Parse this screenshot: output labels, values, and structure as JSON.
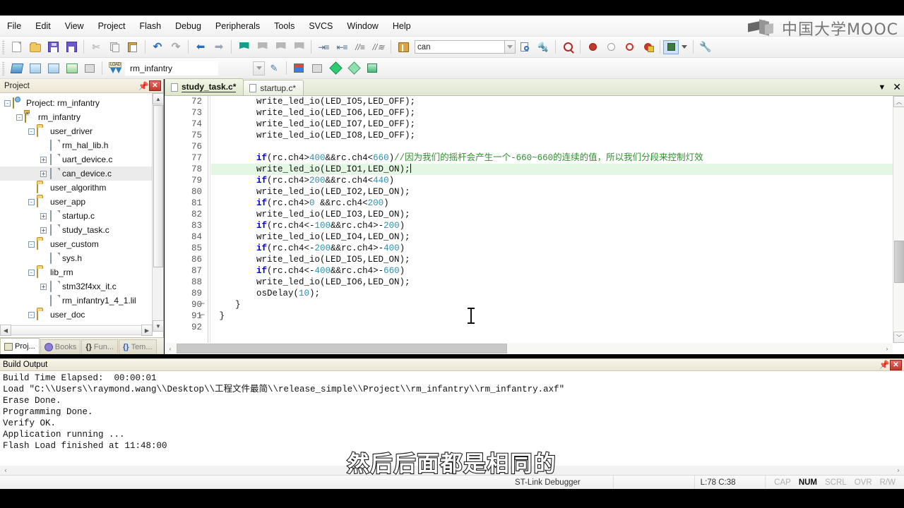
{
  "app": {
    "title": "Keil uVision",
    "logo_text": "中国大学MOOC"
  },
  "menubar": {
    "items": [
      "File",
      "Edit",
      "View",
      "Project",
      "Flash",
      "Debug",
      "Peripherals",
      "Tools",
      "SVCS",
      "Window",
      "Help"
    ]
  },
  "toolbar": {
    "search_value": "can",
    "search_placeholder": "",
    "target_value": "rm_infantry"
  },
  "project_panel": {
    "title": "Project",
    "tree": [
      {
        "label": "Project: rm_infantry",
        "depth": 0,
        "expander": "-",
        "icon": "project-icon",
        "selected": false
      },
      {
        "label": "rm_infantry",
        "depth": 1,
        "expander": "-",
        "icon": "target-icon",
        "selected": false
      },
      {
        "label": "user_driver",
        "depth": 2,
        "expander": "-",
        "icon": "folder-icon",
        "selected": false
      },
      {
        "label": "rm_hal_lib.h",
        "depth": 3,
        "expander": "",
        "icon": "file-icon",
        "selected": false
      },
      {
        "label": "uart_device.c",
        "depth": 3,
        "expander": "+",
        "icon": "file-icon",
        "selected": false
      },
      {
        "label": "can_device.c",
        "depth": 3,
        "expander": "+",
        "icon": "file-icon",
        "selected": true
      },
      {
        "label": "user_algorithm",
        "depth": 2,
        "expander": "",
        "icon": "folder-icon",
        "selected": false
      },
      {
        "label": "user_app",
        "depth": 2,
        "expander": "-",
        "icon": "folder-icon",
        "selected": false
      },
      {
        "label": "startup.c",
        "depth": 3,
        "expander": "+",
        "icon": "file-icon",
        "selected": false
      },
      {
        "label": "study_task.c",
        "depth": 3,
        "expander": "+",
        "icon": "file-icon",
        "selected": false
      },
      {
        "label": "user_custom",
        "depth": 2,
        "expander": "-",
        "icon": "folder-icon",
        "selected": false
      },
      {
        "label": "sys.h",
        "depth": 3,
        "expander": "",
        "icon": "file-icon",
        "selected": false
      },
      {
        "label": "lib_rm",
        "depth": 2,
        "expander": "-",
        "icon": "folder-icon",
        "selected": false
      },
      {
        "label": "stm32f4xx_it.c",
        "depth": 3,
        "expander": "+",
        "icon": "file-icon",
        "selected": false
      },
      {
        "label": "rm_infantry1_4_1.lil",
        "depth": 3,
        "expander": "",
        "icon": "file-icon",
        "selected": false
      },
      {
        "label": "user_doc",
        "depth": 2,
        "expander": "-",
        "icon": "folder-icon",
        "selected": false
      }
    ],
    "tabs": [
      {
        "label": "Proj...",
        "active": true,
        "icon": "project-tab-icon"
      },
      {
        "label": "Books",
        "active": false,
        "icon": "books-tab-icon"
      },
      {
        "label": "Fun...",
        "active": false,
        "icon": "functions-tab-icon"
      },
      {
        "label": "Tem...",
        "active": false,
        "icon": "templates-tab-icon"
      }
    ]
  },
  "editor": {
    "tabs": [
      {
        "label": "startup.c*",
        "active": false
      },
      {
        "label": "study_task.c*",
        "active": true
      }
    ],
    "first_line_number": 72,
    "lines": [
      {
        "n": 72,
        "indent": 8,
        "tokens": [
          {
            "t": "write_led_io(LED_IO5,LED_OFF);",
            "c": "plain"
          }
        ],
        "highlight": false
      },
      {
        "n": 73,
        "indent": 8,
        "tokens": [
          {
            "t": "write_led_io(LED_IO6,LED_OFF);",
            "c": "plain"
          }
        ],
        "highlight": false
      },
      {
        "n": 74,
        "indent": 8,
        "tokens": [
          {
            "t": "write_led_io(LED_IO7,LED_OFF);",
            "c": "plain"
          }
        ],
        "highlight": false
      },
      {
        "n": 75,
        "indent": 8,
        "tokens": [
          {
            "t": "write_led_io(LED_IO8,LED_OFF);",
            "c": "plain"
          }
        ],
        "highlight": false
      },
      {
        "n": 76,
        "indent": 0,
        "tokens": [],
        "highlight": false
      },
      {
        "n": 77,
        "indent": 8,
        "tokens": [
          {
            "t": "if",
            "c": "kw"
          },
          {
            "t": "(rc.ch4>",
            "c": "plain"
          },
          {
            "t": "400",
            "c": "num"
          },
          {
            "t": "&&rc.ch4<",
            "c": "plain"
          },
          {
            "t": "660",
            "c": "num"
          },
          {
            "t": ")",
            "c": "plain"
          },
          {
            "t": "//因为我们的摇杆会产生一个-660~660的连续的值，所以我们分段来控制灯效",
            "c": "com"
          }
        ],
        "highlight": false
      },
      {
        "n": 78,
        "indent": 8,
        "tokens": [
          {
            "t": "write_led_io(LED_IO1,LED_ON);",
            "c": "plain"
          }
        ],
        "highlight": true,
        "caret": true
      },
      {
        "n": 79,
        "indent": 8,
        "tokens": [
          {
            "t": "if",
            "c": "kw"
          },
          {
            "t": "(rc.ch4>",
            "c": "plain"
          },
          {
            "t": "200",
            "c": "num"
          },
          {
            "t": "&&rc.ch4<",
            "c": "plain"
          },
          {
            "t": "440",
            "c": "num"
          },
          {
            "t": ")",
            "c": "plain"
          }
        ],
        "highlight": false
      },
      {
        "n": 80,
        "indent": 8,
        "tokens": [
          {
            "t": "write_led_io(LED_IO2,LED_ON);",
            "c": "plain"
          }
        ],
        "highlight": false
      },
      {
        "n": 81,
        "indent": 8,
        "tokens": [
          {
            "t": "if",
            "c": "kw"
          },
          {
            "t": "(rc.ch4>",
            "c": "plain"
          },
          {
            "t": "0",
            "c": "num"
          },
          {
            "t": " &&rc.ch4<",
            "c": "plain"
          },
          {
            "t": "200",
            "c": "num"
          },
          {
            "t": ")",
            "c": "plain"
          }
        ],
        "highlight": false
      },
      {
        "n": 82,
        "indent": 8,
        "tokens": [
          {
            "t": "write_led_io(LED_IO3,LED_ON);",
            "c": "plain"
          }
        ],
        "highlight": false
      },
      {
        "n": 83,
        "indent": 8,
        "tokens": [
          {
            "t": "if",
            "c": "kw"
          },
          {
            "t": "(rc.ch4<-",
            "c": "plain"
          },
          {
            "t": "100",
            "c": "num"
          },
          {
            "t": "&&rc.ch4>-",
            "c": "plain"
          },
          {
            "t": "200",
            "c": "num"
          },
          {
            "t": ")",
            "c": "plain"
          }
        ],
        "highlight": false
      },
      {
        "n": 84,
        "indent": 8,
        "tokens": [
          {
            "t": "write_led_io(LED_IO4,LED_ON);",
            "c": "plain"
          }
        ],
        "highlight": false
      },
      {
        "n": 85,
        "indent": 8,
        "tokens": [
          {
            "t": "if",
            "c": "kw"
          },
          {
            "t": "(rc.ch4<-",
            "c": "plain"
          },
          {
            "t": "200",
            "c": "num"
          },
          {
            "t": "&&rc.ch4>-",
            "c": "plain"
          },
          {
            "t": "400",
            "c": "num"
          },
          {
            "t": ")",
            "c": "plain"
          }
        ],
        "highlight": false
      },
      {
        "n": 86,
        "indent": 8,
        "tokens": [
          {
            "t": "write_led_io(LED_IO5,LED_ON);",
            "c": "plain"
          }
        ],
        "highlight": false
      },
      {
        "n": 87,
        "indent": 8,
        "tokens": [
          {
            "t": "if",
            "c": "kw"
          },
          {
            "t": "(rc.ch4<-",
            "c": "plain"
          },
          {
            "t": "400",
            "c": "num"
          },
          {
            "t": "&&rc.ch4>-",
            "c": "plain"
          },
          {
            "t": "660",
            "c": "num"
          },
          {
            "t": ")",
            "c": "plain"
          }
        ],
        "highlight": false
      },
      {
        "n": 88,
        "indent": 8,
        "tokens": [
          {
            "t": "write_led_io(LED_IO6,LED_ON);",
            "c": "plain"
          }
        ],
        "highlight": false
      },
      {
        "n": 89,
        "indent": 8,
        "tokens": [
          {
            "t": "osDelay(",
            "c": "plain"
          },
          {
            "t": "10",
            "c": "num"
          },
          {
            "t": ");",
            "c": "plain"
          }
        ],
        "highlight": false
      },
      {
        "n": 90,
        "indent": 4,
        "tokens": [
          {
            "t": "}",
            "c": "plain"
          }
        ],
        "highlight": false
      },
      {
        "n": 91,
        "indent": 1,
        "tokens": [
          {
            "t": "}",
            "c": "plain"
          }
        ],
        "highlight": false
      },
      {
        "n": 92,
        "indent": 0,
        "tokens": [],
        "highlight": false
      }
    ]
  },
  "build_output": {
    "title": "Build Output",
    "lines": [
      "Build Time Elapsed:  00:00:01",
      "Load \"C:\\\\Users\\\\raymond.wang\\\\Desktop\\\\工程文件最简\\\\release_simple\\\\Project\\\\rm_infantry\\\\rm_infantry.axf\"",
      "Erase Done.",
      "Programming Done.",
      "Verify OK.",
      "Application running ...",
      "Flash Load finished at 11:48:00"
    ]
  },
  "statusbar": {
    "debugger": "ST-Link Debugger",
    "position": "L:78 C:38",
    "flags": [
      {
        "label": "CAP",
        "on": false
      },
      {
        "label": "NUM",
        "on": true
      },
      {
        "label": "SCRL",
        "on": false
      },
      {
        "label": "OVR",
        "on": false
      },
      {
        "label": "R/W",
        "on": false
      }
    ]
  },
  "subtitle": {
    "text": "然后后面都是相同的"
  },
  "colors": {
    "keyword": "#0000c8",
    "number": "#2f8fae",
    "comment": "#2f8f2f",
    "highlight_line": "#e4f7e4",
    "accent": "#c0392b"
  }
}
